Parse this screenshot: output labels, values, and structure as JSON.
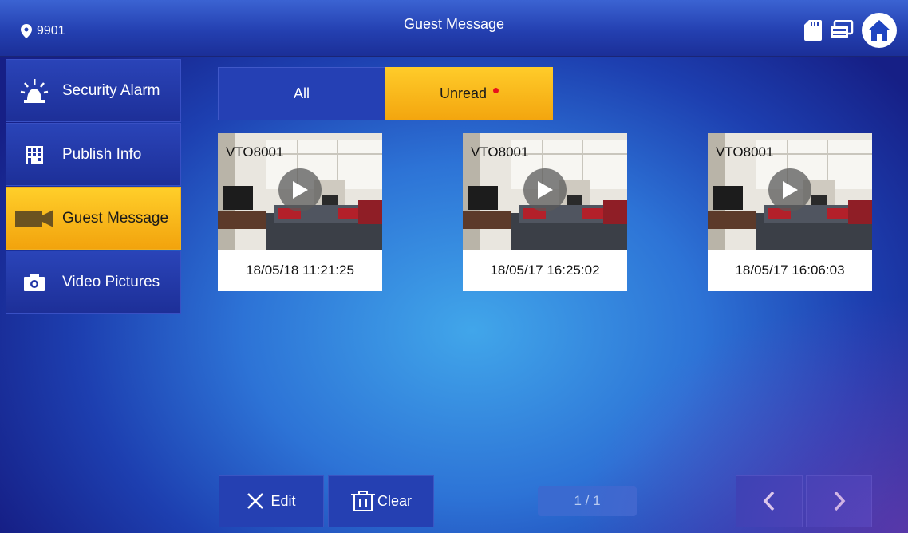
{
  "header": {
    "room_number": "9901",
    "title": "Guest Message"
  },
  "sidebar": {
    "items": [
      {
        "label": "Security Alarm",
        "icon": "alarm-icon",
        "active": false
      },
      {
        "label": "Publish Info",
        "icon": "building-icon",
        "active": false
      },
      {
        "label": "Guest Message",
        "icon": "camera-icon",
        "active": true
      },
      {
        "label": "Video Pictures",
        "icon": "photo-camera-icon",
        "active": false
      }
    ]
  },
  "tabs": [
    {
      "label": "All",
      "active": false
    },
    {
      "label": "Unread",
      "active": true,
      "unread_dot": true
    }
  ],
  "messages": [
    {
      "device": "VTO8001",
      "timestamp": "18/05/18 11:21:25"
    },
    {
      "device": "VTO8001",
      "timestamp": "18/05/17 16:25:02"
    },
    {
      "device": "VTO8001",
      "timestamp": "18/05/17 16:06:03"
    }
  ],
  "footer": {
    "edit_label": "Edit",
    "clear_label": "Clear",
    "page_indicator": "1 / 1"
  },
  "colors": {
    "accent": "#f5a70f",
    "panel": "#2540b4",
    "unread_dot": "#e8121b"
  }
}
